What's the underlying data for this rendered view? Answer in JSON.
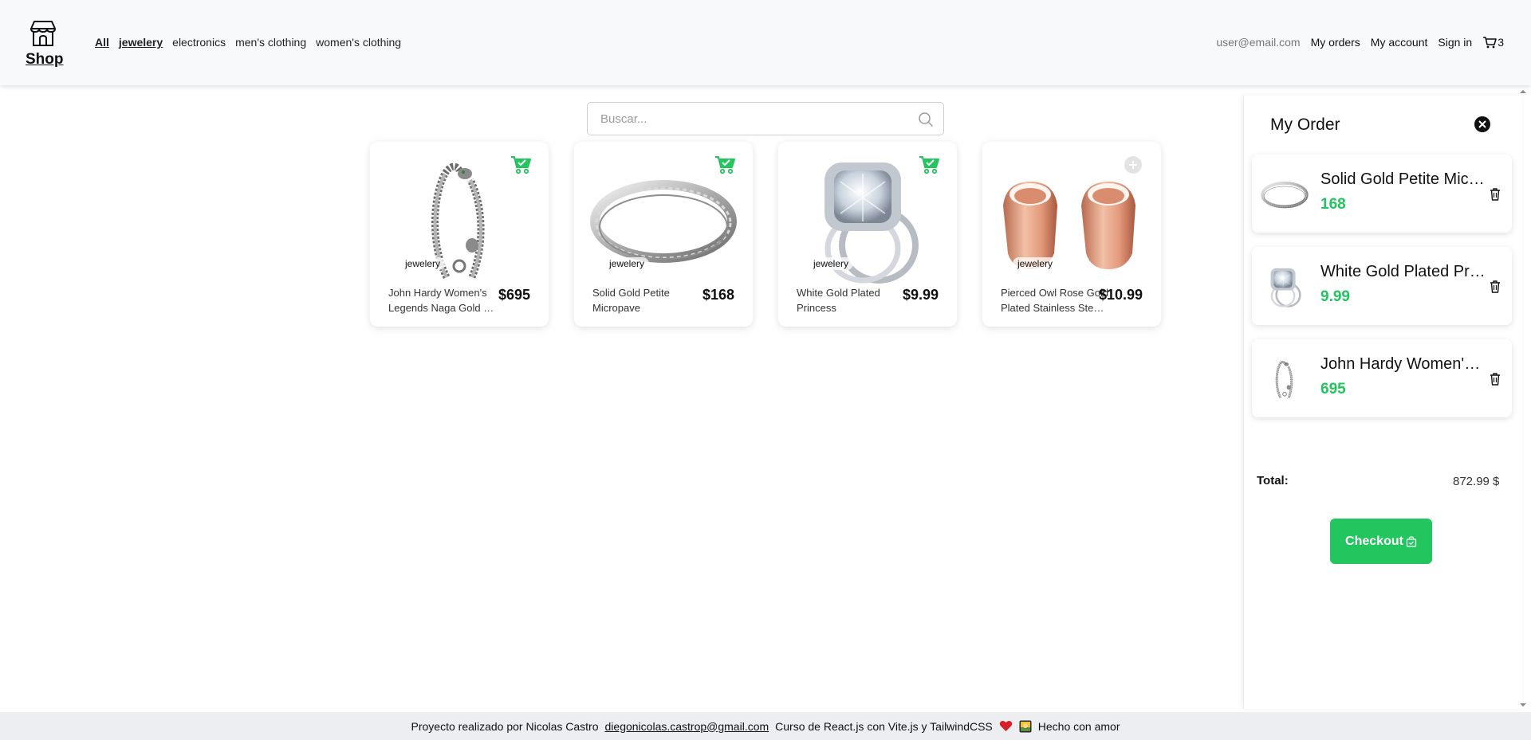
{
  "navbar": {
    "logo_text": "Shop",
    "categories": [
      {
        "label": "All",
        "active": true
      },
      {
        "label": "jewelery",
        "active": true
      },
      {
        "label": "electronics",
        "active": false
      },
      {
        "label": "men's clothing",
        "active": false
      },
      {
        "label": "women's clothing",
        "active": false
      }
    ],
    "email": "user@email.com",
    "my_orders": "My orders",
    "my_account": "My account",
    "sign_in": "Sign in",
    "cart_count": "3"
  },
  "search": {
    "placeholder": "Buscar..."
  },
  "products": [
    {
      "category": "jewelery",
      "name": "John Hardy Women's Legends Naga Gold & Silver Dragon Station Chain Bracelet",
      "price": "$695",
      "in_cart": true,
      "image_icon": "dragon-bracelet"
    },
    {
      "category": "jewelery",
      "name": "Solid Gold Petite Micropave",
      "price": "$168",
      "in_cart": true,
      "image_icon": "silver-band-ring"
    },
    {
      "category": "jewelery",
      "name": "White Gold Plated Princess",
      "price": "$9.99",
      "in_cart": true,
      "image_icon": "diamond-ring"
    },
    {
      "category": "jewelery",
      "name": "Pierced Owl Rose Gold Plated Stainless Steel Double",
      "price": "$10.99",
      "in_cart": false,
      "image_icon": "rose-gold-tunnels"
    }
  ],
  "order": {
    "title": "My Order",
    "items": [
      {
        "name": "Solid Gold Petite Micropave",
        "price": "168",
        "image_icon": "silver-band-ring"
      },
      {
        "name": "White Gold Plated Princess",
        "price": "9.99",
        "image_icon": "diamond-ring"
      },
      {
        "name": "John Hardy Women's Legends Naga",
        "price": "695",
        "image_icon": "dragon-bracelet"
      }
    ],
    "total_label": "Total:",
    "total_value": "872.99 $",
    "checkout_label": "Checkout"
  },
  "footer": {
    "text_1": "Proyecto realizado por Nicolas Castro",
    "email": "diegonicolas.castrop@gmail.com",
    "text_2": "Curso de React.js con Vite.js y TailwindCSS",
    "text_3": "Hecho con amor"
  },
  "colors": {
    "accent_green": "#22c55e",
    "navbar_bg": "#f8f9fb",
    "footer_bg": "#eceef1"
  }
}
